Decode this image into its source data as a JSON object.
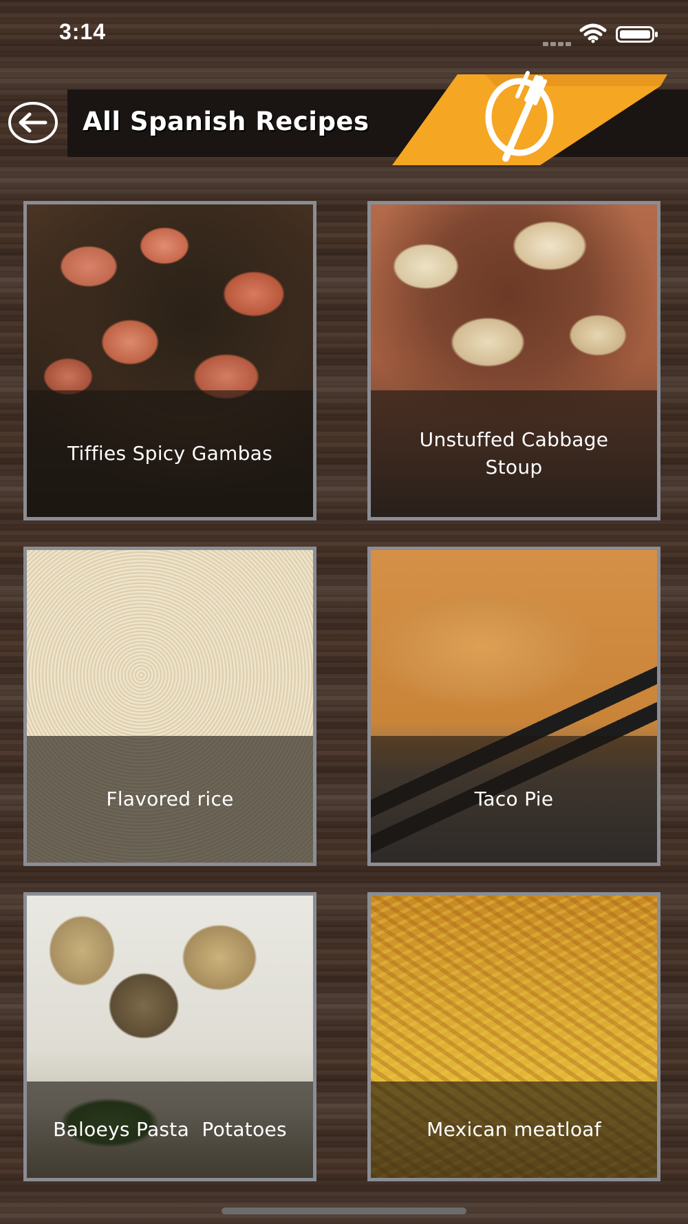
{
  "status_bar": {
    "time": "3:14",
    "wifi_icon": "wifi-icon",
    "battery_icon": "battery-icon"
  },
  "header": {
    "back_icon": "back-arrow-icon",
    "title": "All Spanish Recipes",
    "logo_icon": "fork-knife-logo-icon",
    "accent_color": "#f5a623"
  },
  "recipes": [
    {
      "name": "Tiffies Spicy Gambas",
      "image": "shrimp-photo"
    },
    {
      "name": "Unstuffed Cabbage Stoup",
      "image": "cabbage-soup-photo"
    },
    {
      "name": "Flavored rice",
      "image": "rice-photo"
    },
    {
      "name": "Taco Pie",
      "image": "taco-pie-photo"
    },
    {
      "name": "Baloeys Pasta  Potatoes",
      "image": "pasta-potatoes-photo"
    },
    {
      "name": "Mexican meatloaf",
      "image": "meatloaf-photo"
    }
  ]
}
